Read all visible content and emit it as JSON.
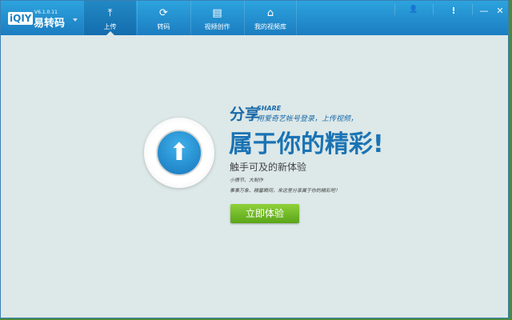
{
  "app": {
    "logo": "iQIY",
    "name": "易转码",
    "version": "V6.1.0.11"
  },
  "tabs": [
    {
      "label": "上传",
      "icon": "upload-icon",
      "glyph": "⤒",
      "active": true
    },
    {
      "label": "转码",
      "icon": "convert-icon",
      "glyph": "⟳"
    },
    {
      "label": "视频创作",
      "icon": "film-icon",
      "glyph": "▤"
    },
    {
      "label": "我的视频库",
      "icon": "library-icon",
      "glyph": "⌂"
    }
  ],
  "controls": {
    "user": "👤",
    "notice": "!",
    "minimize": "—",
    "close": "✕"
  },
  "main": {
    "share_title": "分享",
    "share_en": "SHARE",
    "share_sub": "用爱奇艺帐号登录，上传视频，",
    "headline": "属于你的精彩!",
    "subhead": "触手可及的新体验",
    "hand1": "小情节、大制作",
    "hand2": "事事万象、精馨瞬间，来这里分享属于你的精彩吧！",
    "button": "立即体验",
    "upload_glyph": "⬆"
  },
  "colors": {
    "header": "#1f8ccd",
    "accent": "#1a73b4",
    "button": "#6fbb23"
  }
}
